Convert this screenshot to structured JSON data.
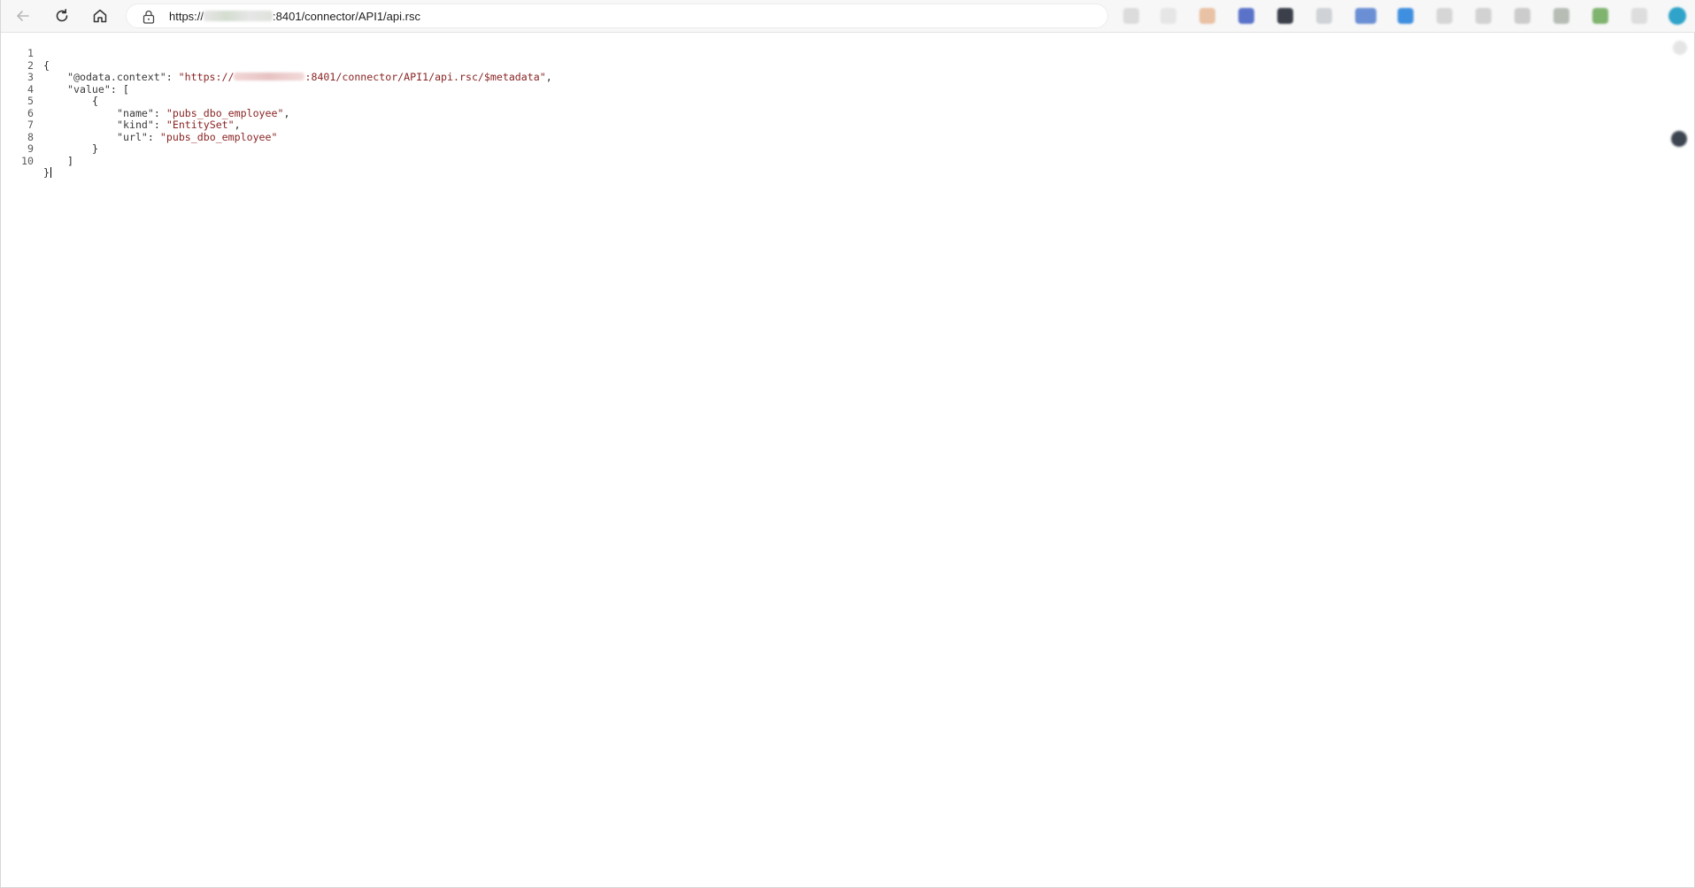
{
  "toolbar": {
    "url_prefix": "https://",
    "url_suffix": ":8401/connector/API1/api.rsc"
  },
  "icons": {
    "back": "arrow-left-icon",
    "reload": "reload-icon",
    "home": "home-icon",
    "lock": "lock-icon"
  },
  "json_view": {
    "line_numbers": [
      "1",
      "2",
      "3",
      "4",
      "5",
      "6",
      "7",
      "8",
      "9",
      "10"
    ],
    "lines": {
      "l1": "{",
      "l2_key": "\"@odata.context\"",
      "l2_sep": ": ",
      "l2_val_prefix": "\"https://",
      "l2_val_suffix": ":8401/connector/API1/api.rsc/$metadata\"",
      "l2_end": ",",
      "l3_key": "\"value\"",
      "l3_rest": ": [",
      "l4": "{",
      "l5_key": "\"name\"",
      "l5_sep": ": ",
      "l5_val": "\"pubs_dbo_employee\"",
      "l5_end": ",",
      "l6_key": "\"kind\"",
      "l6_sep": ": ",
      "l6_val": "\"EntitySet\"",
      "l6_end": ",",
      "l7_key": "\"url\"",
      "l7_sep": ": ",
      "l7_val": "\"pubs_dbo_employee\"",
      "l8": "}",
      "l9": "]",
      "l10": "}"
    }
  },
  "colors": {
    "string": "#8a2424",
    "text": "#1f1f1f",
    "line_number": "#595959"
  }
}
